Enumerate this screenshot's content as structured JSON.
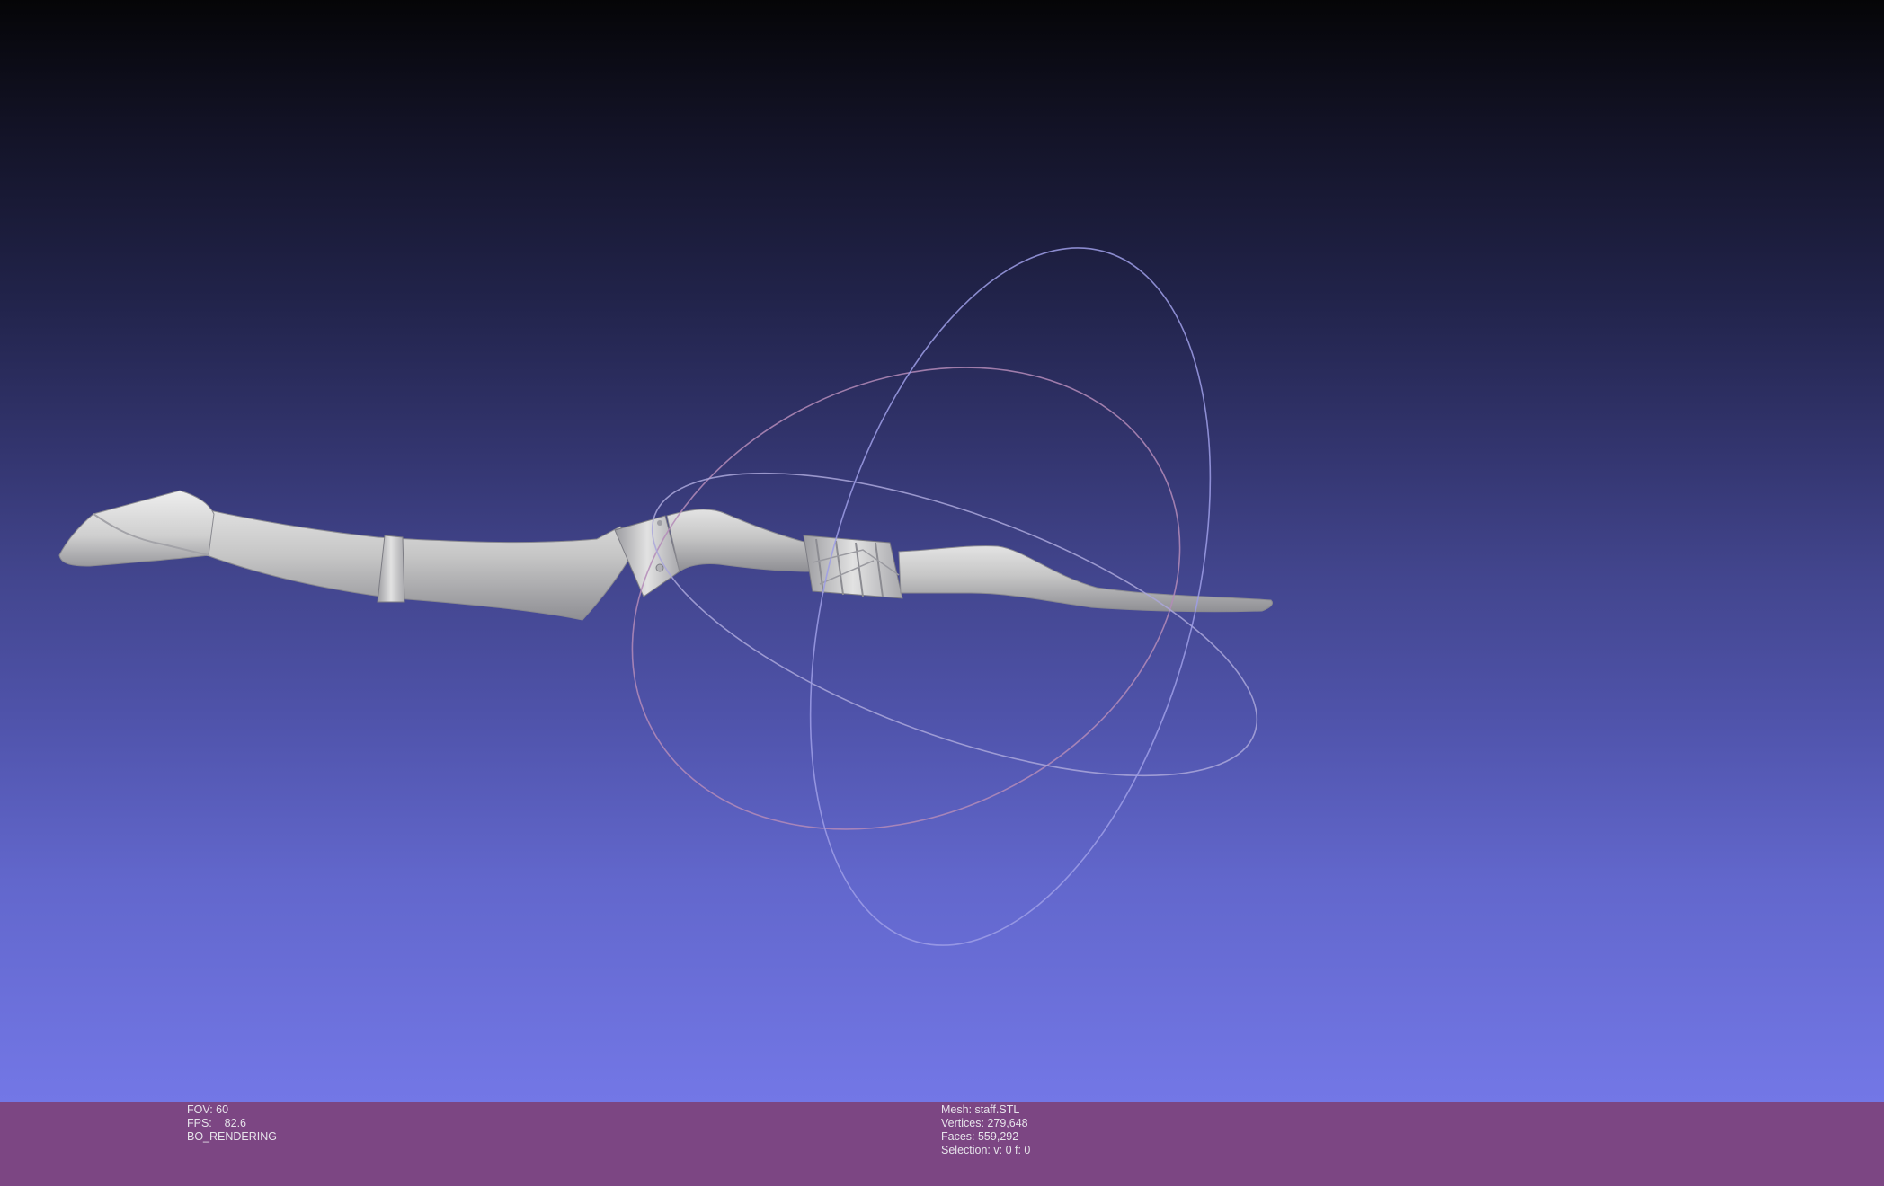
{
  "viewport": {
    "background_top": "#050507",
    "background_bottom": "#7377e6",
    "mesh_color": "#c7c7c7",
    "trackball_colors": [
      "#b48bb8",
      "#9d9ee6",
      "#aaa7da"
    ]
  },
  "info_bar": {
    "background": "#7c4683",
    "text_color": "#e6e3ea",
    "render": {
      "fov": "FOV: 60",
      "fps": "FPS:    82.6",
      "mode": "BO_RENDERING"
    },
    "mesh": {
      "name": "Mesh: staff.STL",
      "vertices": "Vertices: 279,648",
      "faces": "Faces: 559,292",
      "selection": "Selection: v: 0 f: 0"
    }
  }
}
